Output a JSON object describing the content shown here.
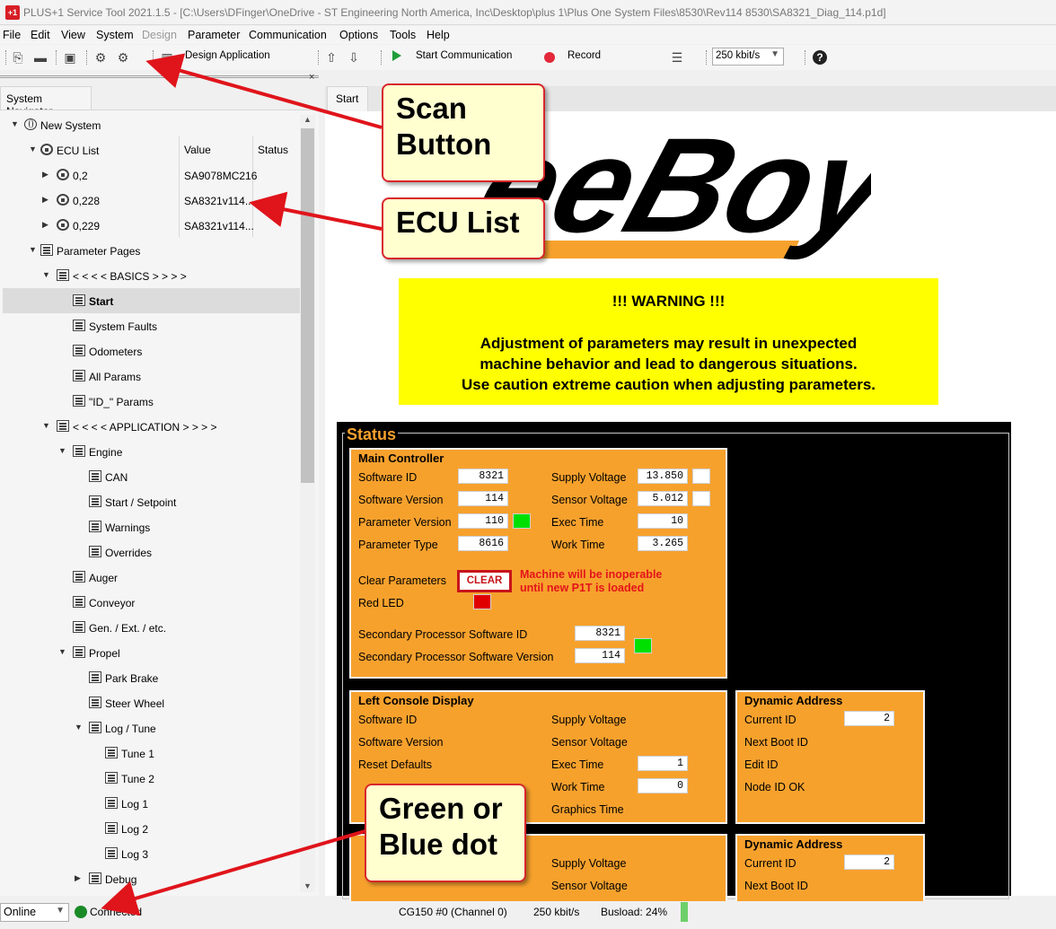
{
  "window": {
    "title": "PLUS+1 Service Tool 2021.1.5 - [C:\\Users\\DFinger\\OneDrive - ST Engineering North America, Inc\\Desktop\\plus 1\\Plus One System Files\\8530\\Rev114 8530\\SA8321_Diag_114.p1d]"
  },
  "menu": [
    "File",
    "Edit",
    "View",
    "System",
    "Design",
    "Parameter",
    "Communication",
    "Options",
    "Tools",
    "Help"
  ],
  "toolbar": {
    "design_app": "Design Application",
    "start_comm": "Start Communication",
    "record": "Record",
    "baud": "250 kbit/s"
  },
  "navigator": {
    "tab": "System Navigator",
    "columns": {
      "value": "Value",
      "status": "Status"
    },
    "tree": [
      {
        "label": "New System"
      },
      {
        "label": "ECU List"
      },
      {
        "label": "0,2",
        "value": "SA9078MC216"
      },
      {
        "label": "0,228",
        "value": "SA8321v114..."
      },
      {
        "label": "0,229",
        "value": "SA8321v114..."
      },
      {
        "label": "Parameter Pages"
      },
      {
        "label": "< < < < BASICS > > > >"
      },
      {
        "label": "Start"
      },
      {
        "label": "System Faults"
      },
      {
        "label": "Odometers"
      },
      {
        "label": "All Params"
      },
      {
        "label": "\"ID_\" Params"
      },
      {
        "label": "< < < < APPLICATION > > > >"
      },
      {
        "label": "Engine"
      },
      {
        "label": "CAN"
      },
      {
        "label": "Start / Setpoint"
      },
      {
        "label": "Warnings"
      },
      {
        "label": "Overrides"
      },
      {
        "label": "Auger"
      },
      {
        "label": "Conveyor"
      },
      {
        "label": "Gen. /  Ext. / etc."
      },
      {
        "label": "Propel"
      },
      {
        "label": "Park Brake"
      },
      {
        "label": "Steer Wheel"
      },
      {
        "label": "Log / Tune"
      },
      {
        "label": "Tune 1"
      },
      {
        "label": "Tune 2"
      },
      {
        "label": "Log 1"
      },
      {
        "label": "Log 2"
      },
      {
        "label": "Log 3"
      },
      {
        "label": "Debug"
      }
    ]
  },
  "main": {
    "tab": "Start",
    "warning": {
      "title": "!!!  WARNING  !!!",
      "line1": "Adjustment of parameters may result in unexpected",
      "line2": "machine behavior and lead to dangerous situations.",
      "line3": "Use caution extreme caution when adjusting parameters."
    },
    "status_title": "Status",
    "main_controller": {
      "title": "Main Controller",
      "software_id": {
        "label": "Software ID",
        "value": "8321"
      },
      "software_version": {
        "label": "Software Version",
        "value": "114"
      },
      "parameter_version": {
        "label": "Parameter Version",
        "value": "110"
      },
      "parameter_type": {
        "label": "Parameter Type",
        "value": "8616"
      },
      "supply_voltage": {
        "label": "Supply Voltage",
        "value": "13.850"
      },
      "sensor_voltage": {
        "label": "Sensor Voltage",
        "value": "5.012"
      },
      "exec_time": {
        "label": "Exec Time",
        "value": "10"
      },
      "work_time": {
        "label": "Work Time",
        "value": "3.265"
      },
      "clear_params": "Clear Parameters",
      "clear_button": "CLEAR",
      "clear_warning_1": "Machine will be inoperable",
      "clear_warning_2": "until new P1T is loaded",
      "red_led": "Red LED",
      "sec_sw_id": {
        "label": "Secondary Processor Software ID",
        "value": "8321"
      },
      "sec_sw_version": {
        "label": "Secondary Processor Software Version",
        "value": "114"
      }
    },
    "left_console": {
      "title": "Left Console Display",
      "software_id": "Software ID",
      "software_version": "Software Version",
      "reset_defaults": "Reset Defaults",
      "supply_voltage": "Supply Voltage",
      "sensor_voltage": "Sensor Voltage",
      "exec_time": {
        "label": "Exec Time",
        "value": "1"
      },
      "work_time": {
        "label": "Work Time",
        "value": "0"
      },
      "graphics_time": "Graphics Time"
    },
    "dynamic_address_1": {
      "title": "Dynamic Address",
      "current_id": {
        "label": "Current ID",
        "value": "2"
      },
      "next_boot_id": "Next Boot ID",
      "edit_id": "Edit ID",
      "node_id_ok": "Node ID OK"
    },
    "lower_group": {
      "supply_voltage": "Supply Voltage",
      "sensor_voltage": "Sensor Voltage"
    },
    "dynamic_address_2": {
      "title": "Dynamic Address",
      "current_id": {
        "label": "Current ID",
        "value": "2"
      },
      "next_boot_id": "Next Boot ID"
    }
  },
  "statusbar": {
    "mode": "Online",
    "connection": "Connected",
    "channel": "CG150 #0 (Channel 0)",
    "baud": "250 kbit/s",
    "busload": "Busload: 24%",
    "busload_value": 24
  },
  "callouts": {
    "scan_1": "Scan",
    "scan_2": "Button",
    "ecu": "ECU List",
    "dot_1": "Green or",
    "dot_2": "Blue dot"
  },
  "colors": {
    "panel_orange": "#f7a12d",
    "warning_yellow": "#ffff00",
    "connected_green": "#1a8a27",
    "indicator_green": "#00e000",
    "led_red": "#e00000",
    "callout_border": "#d8262c"
  }
}
